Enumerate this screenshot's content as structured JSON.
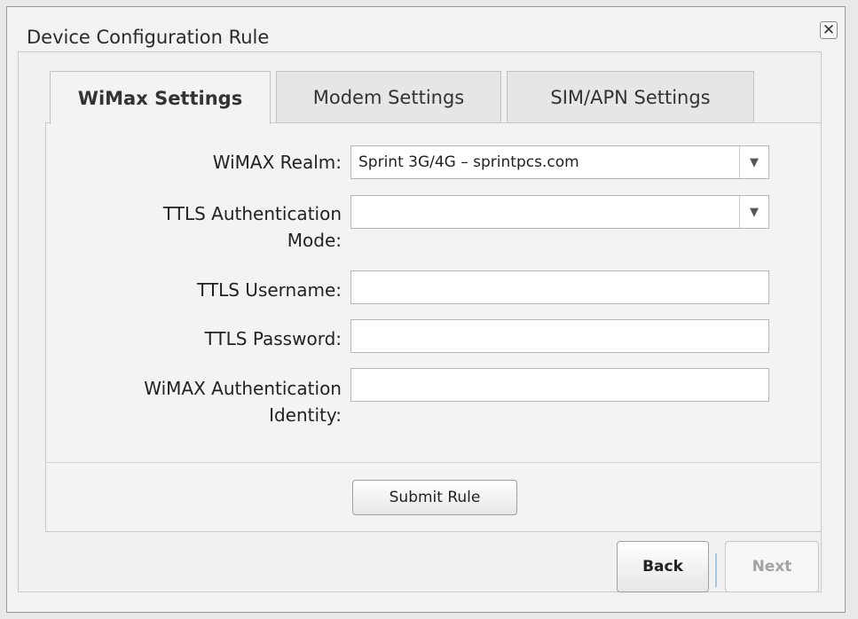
{
  "dialog": {
    "title": "Device Configuration Rule",
    "close_symbol": "✕"
  },
  "tabs": [
    {
      "label": "WiMax Settings",
      "active": true
    },
    {
      "label": "Modem Settings",
      "active": false
    },
    {
      "label": "SIM/APN Settings",
      "active": false
    }
  ],
  "form": {
    "realm_label": "WiMAX Realm:",
    "realm_value": "Sprint 3G/4G – sprintpcs.com",
    "ttls_mode_label_line1": "TTLS Authentication",
    "ttls_mode_label_line2": "Mode:",
    "ttls_mode_value": "",
    "ttls_username_label": "TTLS Username:",
    "ttls_username_value": "",
    "ttls_password_label": "TTLS Password:",
    "ttls_password_value": "",
    "identity_label_line1": "WiMAX Authentication",
    "identity_label_line2": "Identity:",
    "identity_value": "",
    "submit_label": "Submit Rule"
  },
  "footer": {
    "back_label": "Back",
    "next_label": "Next"
  },
  "icons": {
    "close": "close-icon",
    "dropdown": "chevron-down-icon"
  },
  "colors": {
    "separator": "#a8c6e6",
    "disabled_text": "#a3a3a3"
  }
}
